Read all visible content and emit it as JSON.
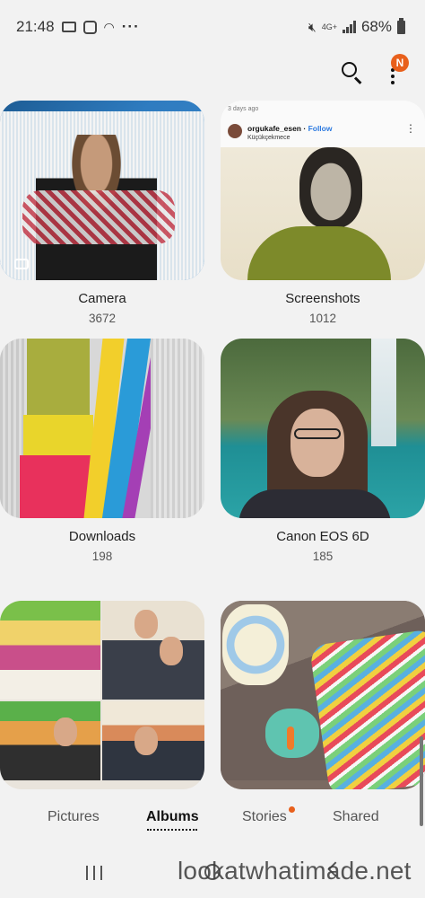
{
  "status_bar": {
    "time": "21:48",
    "dots": "···",
    "network": "4G+",
    "battery": "68%"
  },
  "header": {
    "notification_badge": "N",
    "accent_color": "#e8601c"
  },
  "albums": [
    {
      "name": "Camera",
      "count": "3672"
    },
    {
      "name": "Screenshots",
      "count": "1012"
    },
    {
      "name": "Downloads",
      "count": "198"
    },
    {
      "name": "Canon EOS 6D",
      "count": "185"
    },
    {
      "name": "",
      "count": ""
    },
    {
      "name": "",
      "count": ""
    }
  ],
  "screenshot_thumb": {
    "meta": "3 days ago",
    "username": "orgukafe_esen",
    "follow": "Follow",
    "location": "Küçükçekmece"
  },
  "tabs": [
    {
      "label": "Pictures",
      "active": false
    },
    {
      "label": "Albums",
      "active": true
    },
    {
      "label": "Stories",
      "active": false,
      "has_dot": true
    },
    {
      "label": "Shared",
      "active": false
    }
  ],
  "watermark": "lookatwhatimade.net"
}
